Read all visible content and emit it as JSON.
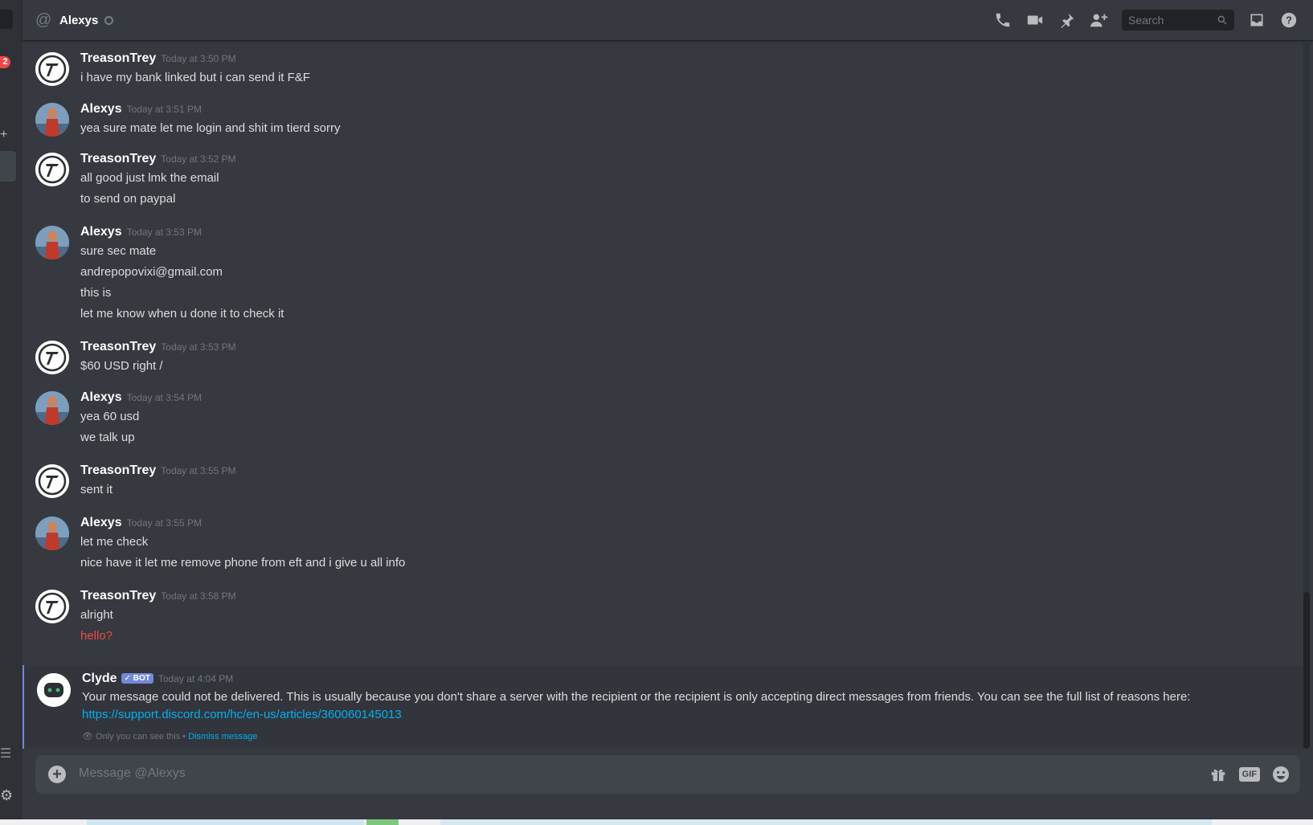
{
  "header": {
    "title": "Alexys",
    "search_placeholder": "Search"
  },
  "left": {
    "badge": "2"
  },
  "messages": [
    {
      "author": "TreasonTrey",
      "time": "Today at 3:50 PM",
      "lines": [
        "i have my bank linked but i can send it F&F"
      ]
    },
    {
      "author": "Alexys",
      "time": "Today at 3:51 PM",
      "lines": [
        "yea sure mate let me login and shit im tierd sorry"
      ]
    },
    {
      "author": "TreasonTrey",
      "time": "Today at 3:52 PM",
      "lines": [
        "all good just lmk the email",
        "to send on paypal"
      ]
    },
    {
      "author": "Alexys",
      "time": "Today at 3:53 PM",
      "lines": [
        "sure sec mate",
        "andrepopovixi@gmail.com",
        "this is",
        "let me know when u done it to check it"
      ]
    },
    {
      "author": "TreasonTrey",
      "time": "Today at 3:53 PM",
      "lines": [
        "$60 USD right /"
      ]
    },
    {
      "author": "Alexys",
      "time": "Today at 3:54 PM",
      "lines": [
        "yea 60 usd",
        "we talk up"
      ]
    },
    {
      "author": "TreasonTrey",
      "time": "Today at 3:55 PM",
      "lines": [
        "sent it"
      ]
    },
    {
      "author": "Alexys",
      "time": "Today at 3:55 PM",
      "lines": [
        "let me check",
        "nice have it let me remove phone from eft and i give u all info"
      ]
    },
    {
      "author": "TreasonTrey",
      "time": "Today at 3:58 PM",
      "lines": [
        "alright",
        "hello?"
      ]
    }
  ],
  "clyde": {
    "author": "Clyde",
    "bot_tag": "✓ BOT",
    "time": "Today at 4:04 PM",
    "text": "Your message could not be delivered. This is usually because you don't share a server with the recipient or the recipient is only accepting direct messages from friends. You can see the full list of reasons here:",
    "link": "https://support.discord.com/hc/en-us/articles/360060145013",
    "ephemeral_note": "Only you can see this •",
    "dismiss": "Dismiss message"
  },
  "composer": {
    "placeholder": "Message @Alexys",
    "gif_label": "GIF"
  },
  "colors": {
    "background": "#36393f",
    "accent": "#7289da",
    "link": "#00b0f4",
    "error": "#f04747"
  }
}
